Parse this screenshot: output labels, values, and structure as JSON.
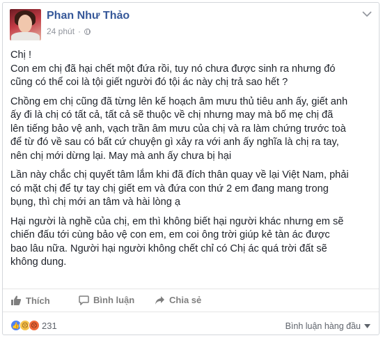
{
  "post": {
    "author": "Phan Như Thảo",
    "time": "24 phút",
    "paragraphs": [
      [
        "Chị !",
        "Con em chị đã hại chết một đứa rồi, tuy nó chưa được sinh ra nhưng đó",
        "cũng có thể coi là tội giết người đó tội ác này chị trả sao hết ?"
      ],
      [
        "Chồng em chị cũng đã từng lên kế hoạch âm mưu thủ tiêu anh ấy, giết anh",
        "ấy đi là chị có tất cả, tất cả sẽ thuộc về chị nhưng may mà bố mẹ chị đã",
        "lên tiếng bảo vệ anh, vạch trần âm mưu của chị và ra làm chứng trước toà",
        "để từ đó về sau có bất cứ chuyện gì xảy ra với anh ấy nghĩa là chị ra tay,",
        "nên chị mới dừng lại. May mà anh ấy chưa bị hại"
      ],
      [
        "Lần này chắc chị quyết tâm lắm khi đã đích thân quay về lại Việt Nam, phải",
        "có mặt chị để tự tay chị giết em và đứa con thứ 2 em đang mang trong",
        "bụng, thì chị mới an tâm và hài lòng ạ"
      ],
      [
        "Hại người là nghề của chị, em thì không biết hại người khác nhưng em sẽ",
        "chiến đấu tới cùng bảo vệ con em, em coi ông trời giúp kẻ tàn ác được",
        "bao lâu nữa. Người hại người không chết chỉ có Chị ác quá trời đất sẽ",
        "không dung."
      ]
    ]
  },
  "actions": {
    "like": "Thích",
    "comment": "Bình luận",
    "share": "Chia sẻ"
  },
  "footer": {
    "reaction_count": "231",
    "reaction_icons": [
      "like-reaction-icon",
      "sad-reaction-icon",
      "angry-reaction-icon"
    ],
    "sort_label": "Bình luận hàng đầu"
  },
  "colors": {
    "author": "#365899",
    "meta": "#90949c",
    "action_text": "#7f7f7f",
    "like_blue": "#4f82f5"
  }
}
